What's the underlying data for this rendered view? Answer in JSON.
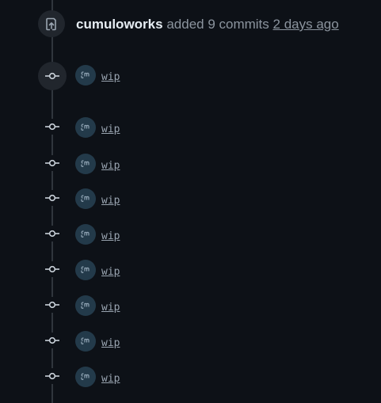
{
  "event": {
    "actor": "cumuloworks",
    "action": "added 9 commits",
    "time_ago": "2 days ago",
    "icon": "repo-push-icon"
  },
  "commits": [
    {
      "message": "wip",
      "avatar": "cumuloworks-avatar"
    },
    {
      "message": "wip",
      "avatar": "cumuloworks-avatar"
    },
    {
      "message": "wip",
      "avatar": "cumuloworks-avatar"
    },
    {
      "message": "wip",
      "avatar": "cumuloworks-avatar"
    },
    {
      "message": "wip",
      "avatar": "cumuloworks-avatar"
    },
    {
      "message": "wip",
      "avatar": "cumuloworks-avatar"
    },
    {
      "message": "wip",
      "avatar": "cumuloworks-avatar"
    },
    {
      "message": "wip",
      "avatar": "cumuloworks-avatar"
    },
    {
      "message": "wip",
      "avatar": "cumuloworks-avatar"
    }
  ],
  "colors": {
    "background": "#0d1117",
    "rail": "#30363d",
    "icon_bg": "#21262d",
    "actor": "#e6edf3",
    "muted": "#8b949e",
    "avatar_bg": "#233a4a"
  }
}
